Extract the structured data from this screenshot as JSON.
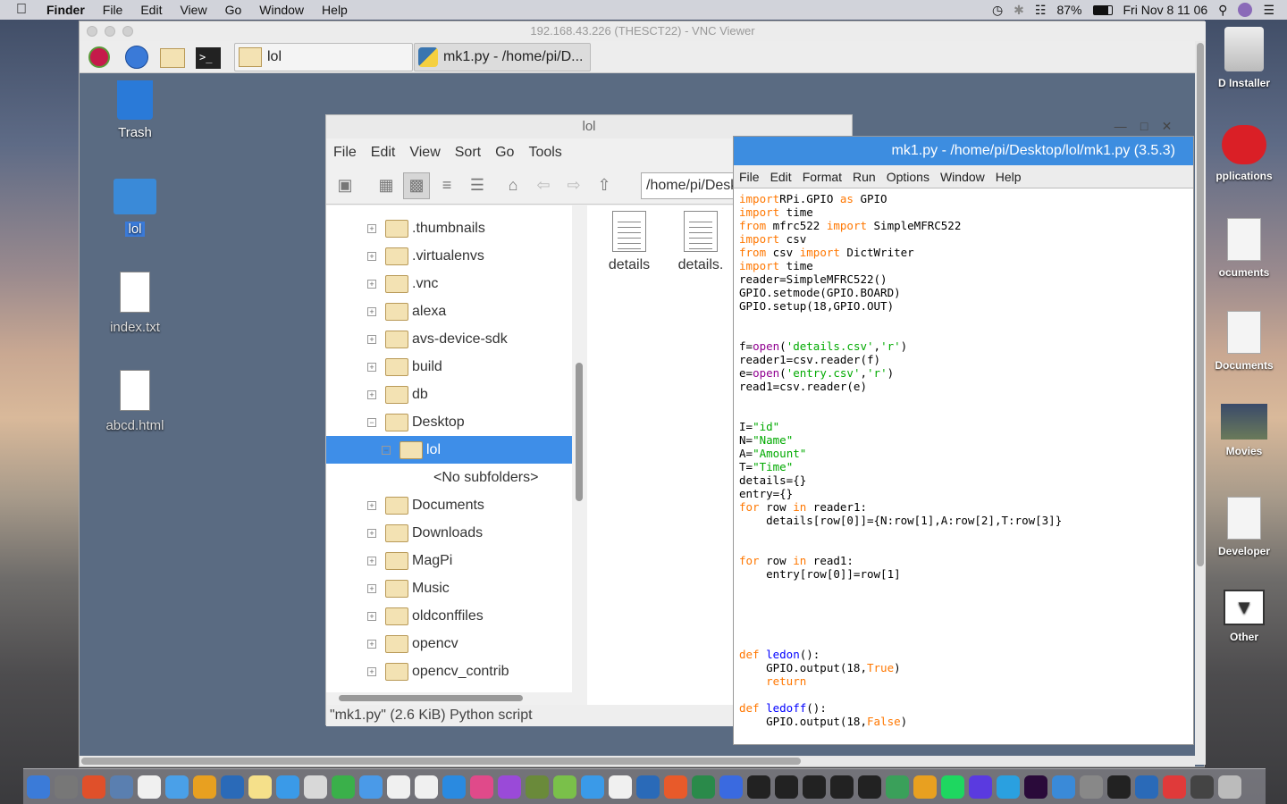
{
  "mac_menubar": {
    "app": "Finder",
    "items": [
      "File",
      "Edit",
      "View",
      "Go",
      "Window",
      "Help"
    ],
    "battery": "87%",
    "datetime": "Fri Nov 8  11 06"
  },
  "right_desktop": [
    {
      "label": "D Installer",
      "icon": "disk-icon"
    },
    {
      "label": "pplications",
      "icon": "creative-cloud-icon"
    },
    {
      "label": "ocuments",
      "icon": "document-icon"
    },
    {
      "label": "Documents",
      "icon": "document-icon"
    },
    {
      "label": "Movies",
      "icon": "movie-thumbnail"
    },
    {
      "label": "Developer",
      "icon": "html-file-icon"
    },
    {
      "label": "Other",
      "icon": "downloads-stack-icon"
    }
  ],
  "vnc": {
    "title": "192.168.43.226 (THESCT22) - VNC Viewer"
  },
  "pi_panel": {
    "tasks": [
      {
        "label": "lol"
      },
      {
        "label": "mk1.py - /home/pi/D..."
      }
    ]
  },
  "pi_desktop": [
    {
      "label": "Trash",
      "icon": "trash-icon"
    },
    {
      "label": "lol",
      "icon": "folder-icon"
    },
    {
      "label": "index.txt",
      "icon": "text-file-icon"
    },
    {
      "label": "abcd.html",
      "icon": "html-globe-icon"
    }
  ],
  "file_manager": {
    "title": "lol",
    "menu": [
      "File",
      "Edit",
      "View",
      "Sort",
      "Go",
      "Tools"
    ],
    "path": "/home/pi/Desktop/lol",
    "tree": [
      {
        "label": ".thumbnails",
        "expander": "+"
      },
      {
        "label": ".virtualenvs",
        "expander": "+"
      },
      {
        "label": ".vnc",
        "expander": "+"
      },
      {
        "label": "alexa",
        "expander": "+"
      },
      {
        "label": "avs-device-sdk",
        "expander": "+"
      },
      {
        "label": "build",
        "expander": "+"
      },
      {
        "label": "db",
        "expander": "+"
      },
      {
        "label": "Desktop",
        "expander": "−"
      },
      {
        "label": "lol",
        "expander": "−"
      },
      {
        "label": "<No subfolders>",
        "expander": ""
      },
      {
        "label": "Documents",
        "expander": "+"
      },
      {
        "label": "Downloads",
        "expander": "+"
      },
      {
        "label": "MagPi",
        "expander": "+"
      },
      {
        "label": "Music",
        "expander": "+"
      },
      {
        "label": "oldconffiles",
        "expander": "+"
      },
      {
        "label": "opencv",
        "expander": "+"
      },
      {
        "label": "opencv_contrib",
        "expander": "+"
      }
    ],
    "files": [
      "details",
      "details."
    ],
    "status": "\"mk1.py\" (2.6 KiB) Python script"
  },
  "idle": {
    "title": "mk1.py - /home/pi/Desktop/lol/mk1.py (3.5.3)",
    "menu": [
      "File",
      "Edit",
      "Format",
      "Run",
      "Options",
      "Window",
      "Help"
    ]
  },
  "code_lines": [
    [
      [
        "kw",
        "import"
      ],
      [
        "",
        "RPi.GPIO "
      ],
      [
        "kw",
        "as"
      ],
      [
        "",
        " GPIO"
      ]
    ],
    [
      [
        "kw",
        "import"
      ],
      [
        "",
        " time"
      ]
    ],
    [
      [
        "kw",
        "from"
      ],
      [
        "",
        " mfrc522 "
      ],
      [
        "kw",
        "import"
      ],
      [
        "",
        " SimpleMFRC522"
      ]
    ],
    [
      [
        "kw",
        "import"
      ],
      [
        "",
        " csv"
      ]
    ],
    [
      [
        "kw",
        "from"
      ],
      [
        "",
        " csv "
      ],
      [
        "kw",
        "import"
      ],
      [
        "",
        " DictWriter"
      ]
    ],
    [
      [
        "kw",
        "import"
      ],
      [
        "",
        " time"
      ]
    ],
    [
      [
        "",
        "reader=SimpleMFRC522()"
      ]
    ],
    [
      [
        "",
        "GPIO.setmode(GPIO.BOARD)"
      ]
    ],
    [
      [
        "",
        "GPIO.setup(18,GPIO.OUT)"
      ]
    ],
    [
      [
        "",
        ""
      ]
    ],
    [
      [
        "",
        ""
      ]
    ],
    [
      [
        "",
        "f="
      ],
      [
        "bi",
        "open"
      ],
      [
        "",
        "("
      ],
      [
        "st",
        "'details.csv'"
      ],
      [
        "",
        ","
      ],
      [
        "st",
        "'r'"
      ],
      [
        "",
        ")"
      ]
    ],
    [
      [
        "",
        "reader1=csv.reader(f)"
      ]
    ],
    [
      [
        "",
        "e="
      ],
      [
        "bi",
        "open"
      ],
      [
        "",
        "("
      ],
      [
        "st",
        "'entry.csv'"
      ],
      [
        "",
        ","
      ],
      [
        "st",
        "'r'"
      ],
      [
        "",
        ")"
      ]
    ],
    [
      [
        "",
        "read1=csv.reader(e)"
      ]
    ],
    [
      [
        "",
        ""
      ]
    ],
    [
      [
        "",
        ""
      ]
    ],
    [
      [
        "",
        "I="
      ],
      [
        "st",
        "\"id\""
      ]
    ],
    [
      [
        "",
        "N="
      ],
      [
        "st",
        "\"Name\""
      ]
    ],
    [
      [
        "",
        "A="
      ],
      [
        "st",
        "\"Amount\""
      ]
    ],
    [
      [
        "",
        "T="
      ],
      [
        "st",
        "\"Time\""
      ]
    ],
    [
      [
        "",
        "details={}"
      ]
    ],
    [
      [
        "",
        "entry={}"
      ]
    ],
    [
      [
        "kw",
        "for"
      ],
      [
        "",
        " row "
      ],
      [
        "kw",
        "in"
      ],
      [
        "",
        " reader1:"
      ]
    ],
    [
      [
        "",
        "    details[row[0]]={N:row[1],A:row[2],T:row[3]}"
      ]
    ],
    [
      [
        "",
        ""
      ]
    ],
    [
      [
        "",
        ""
      ]
    ],
    [
      [
        "kw",
        "for"
      ],
      [
        "",
        " row "
      ],
      [
        "kw",
        "in"
      ],
      [
        "",
        " read1:"
      ]
    ],
    [
      [
        "",
        "    entry[row[0]]=row[1]"
      ]
    ],
    [
      [
        "",
        ""
      ]
    ],
    [
      [
        "",
        ""
      ]
    ],
    [
      [
        "",
        ""
      ]
    ],
    [
      [
        "",
        ""
      ]
    ],
    [
      [
        "",
        ""
      ]
    ],
    [
      [
        "kw",
        "def"
      ],
      [
        "",
        " "
      ],
      [
        "df",
        "ledon"
      ],
      [
        "",
        "():"
      ]
    ],
    [
      [
        "",
        "    GPIO.output(18,"
      ],
      [
        "kw",
        "True"
      ],
      [
        "",
        ")"
      ]
    ],
    [
      [
        "",
        "    "
      ],
      [
        "kw",
        "return"
      ]
    ],
    [
      [
        "",
        ""
      ]
    ],
    [
      [
        "kw",
        "def"
      ],
      [
        "",
        " "
      ],
      [
        "df",
        "ledoff"
      ],
      [
        "",
        "():"
      ]
    ],
    [
      [
        "",
        "    GPIO.output(18,"
      ],
      [
        "kw",
        "False"
      ],
      [
        "",
        ")"
      ]
    ]
  ],
  "dock_colors": [
    "#3b7bd8",
    "#777",
    "#e0502a",
    "#5a7fb0",
    "#f0f0f0",
    "#4aa0e8",
    "#e8a020",
    "#2a6ab8",
    "#f5e08a",
    "#3a9ae8",
    "#d8d8d8",
    "#3ab04a",
    "#4a9ae8",
    "#f0f0f0",
    "#f0f0f0",
    "#2a8ae0",
    "#e04a8a",
    "#9a4ad8",
    "#6a8a3a",
    "#7ac04a",
    "#3a9ae8",
    "#f0f0f0",
    "#2a6ab8",
    "#e85a2a",
    "#2a8a4a",
    "#3a6ae0",
    "#222",
    "#222",
    "#222",
    "#222",
    "#222",
    "#3aa05a",
    "#e8a020",
    "#1ed760",
    "#5a3ae0",
    "#2aa0e0",
    "#2a0a3a",
    "#3a8ad8",
    "#888",
    "#222",
    "#2a6ab8",
    "#e03a3a",
    "#444",
    "#bbb"
  ]
}
